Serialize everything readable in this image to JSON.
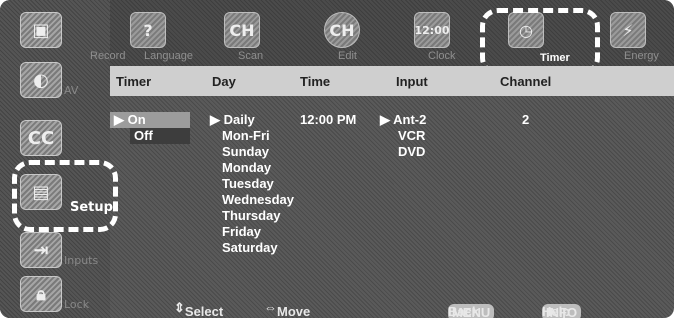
{
  "tabs": [
    {
      "label": "Record",
      "icon": "record-icon"
    },
    {
      "label": "Language",
      "icon": "language-icon"
    },
    {
      "label": "Scan",
      "icon": "scan-icon"
    },
    {
      "label": "Edit",
      "icon": "edit-icon"
    },
    {
      "label": "Clock",
      "icon": "clock-icon"
    },
    {
      "label": "Timer",
      "icon": "timer-icon"
    },
    {
      "label": "Energy",
      "icon": "energy-icon"
    }
  ],
  "tab_glyphs": {
    "language": "?",
    "scan": "CH",
    "edit": "CH",
    "clock": "12:00"
  },
  "sidebar": [
    {
      "label": "AV",
      "icon": "av-icon"
    },
    {
      "label": "",
      "icon": "cc-icon"
    },
    {
      "label": "Setup",
      "icon": "setup-icon"
    },
    {
      "label": "Inputs",
      "icon": "inputs-icon"
    },
    {
      "label": "Lock",
      "icon": "lock-icon"
    }
  ],
  "cc_glyph": "CC",
  "headers": {
    "timer": "Timer",
    "day": "Day",
    "time": "Time",
    "input": "Input",
    "channel": "Channel"
  },
  "timer": {
    "options": [
      "On",
      "Off"
    ],
    "selected": "On"
  },
  "day": {
    "options": [
      "Daily",
      "Mon-Fri",
      "Sunday",
      "Monday",
      "Tuesday",
      "Wednesday",
      "Thursday",
      "Friday",
      "Saturday"
    ],
    "selected": "Daily"
  },
  "time": {
    "value": "12:00 PM"
  },
  "input": {
    "options": [
      "Ant-2",
      "VCR",
      "DVD"
    ],
    "selected": "Ant-2"
  },
  "channel": {
    "value": "2"
  },
  "footer": {
    "select": "Select",
    "move": "Move",
    "menu_key": "MENU",
    "back": "Back",
    "info_key": "INFO",
    "help": "Help"
  },
  "colors": {
    "highlight": "#ffffff",
    "background": "#4f4f4f",
    "header": "#cfcfcf"
  }
}
